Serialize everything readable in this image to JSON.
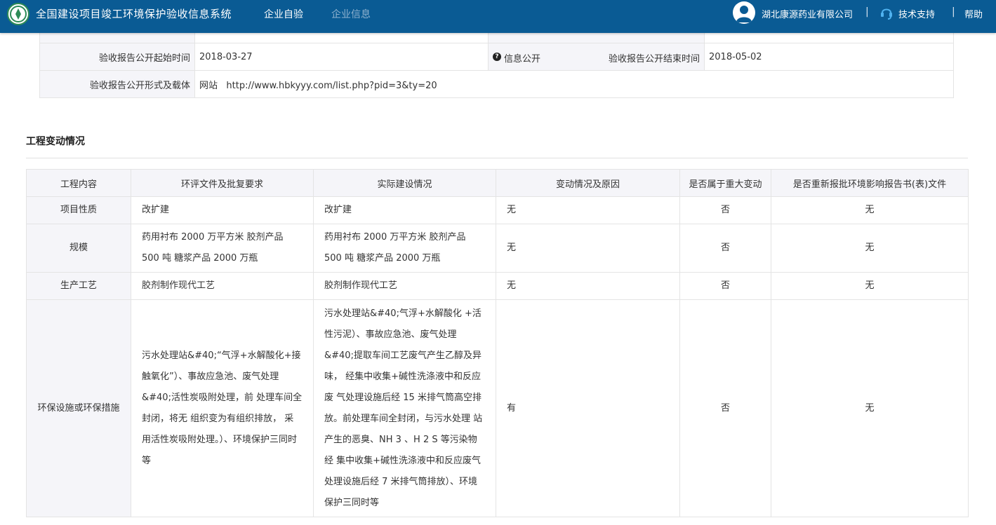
{
  "header": {
    "app_title": "全国建设项目竣工环境保护验收信息系统",
    "nav": [
      "企业自验",
      "企业信息"
    ],
    "user_name": "湖北康源药业有限公司",
    "separator": "|",
    "support": "技术支持",
    "help": "帮助",
    "colors": {
      "bar": "#0a5b94",
      "inactive_nav": "#8fb2cf"
    }
  },
  "info": {
    "start_label": "验收报告公开起始时间",
    "start_value": "2018-03-27",
    "public_tag": "信息公开",
    "end_label": "验收报告公开结束时间",
    "end_value": "2018-05-02",
    "form_label": "验收报告公开形式及载体",
    "form_value": "网站   http://www.hbkyyy.com/list.php?pid=3&ty=20"
  },
  "changes": {
    "title": "工程变动情况",
    "headers": [
      "工程内容",
      "环评文件及批复要求",
      "实际建设情况",
      "变动情况及原因",
      "是否属于重大变动",
      "是否重新报批环境影响报告书(表)文件"
    ],
    "rows": [
      [
        "项目性质",
        "改扩建",
        "改扩建",
        "无",
        "否",
        "无"
      ],
      [
        "规模",
        "药用衬布 2000 万平方米 胶剂产品 500 吨 糖浆产品 2000 万瓶",
        "药用衬布 2000 万平方米 胶剂产品 500 吨 糖浆产品 2000 万瓶",
        "无",
        "否",
        "无"
      ],
      [
        "生产工艺",
        "胶剂制作现代工艺",
        "胶剂制作现代工艺",
        "无",
        "否",
        "无"
      ],
      [
        "环保设施或环保措施",
        "污水处理站&#40;“气浮+水解酸化+接 触氧化”）、事故应急池、废气处理&#40;活性炭吸附处理，前 处理车间全封闭，将无 组织变为有组织排放， 采用活性炭吸附处理。）、环境保护三同时等",
        "污水处理站&#40;气浮+水解酸化 +活性污泥）、事故应急池、废气处理&#40;提取车间工艺废气产生乙醇及异味， 经集中收集+碱性洗涤液中和反应废 气处理设施后经 15 米排气筒高空排 放。前处理车间全封闭，与污水处理 站产生的恶臭、NH 3 、H 2 S 等污染物经 集中收集+碱性洗涤液中和反应废气 处理设施后经 7 米排气筒排放）、环境保护三同时等",
        "有",
        "否",
        "无"
      ]
    ]
  }
}
